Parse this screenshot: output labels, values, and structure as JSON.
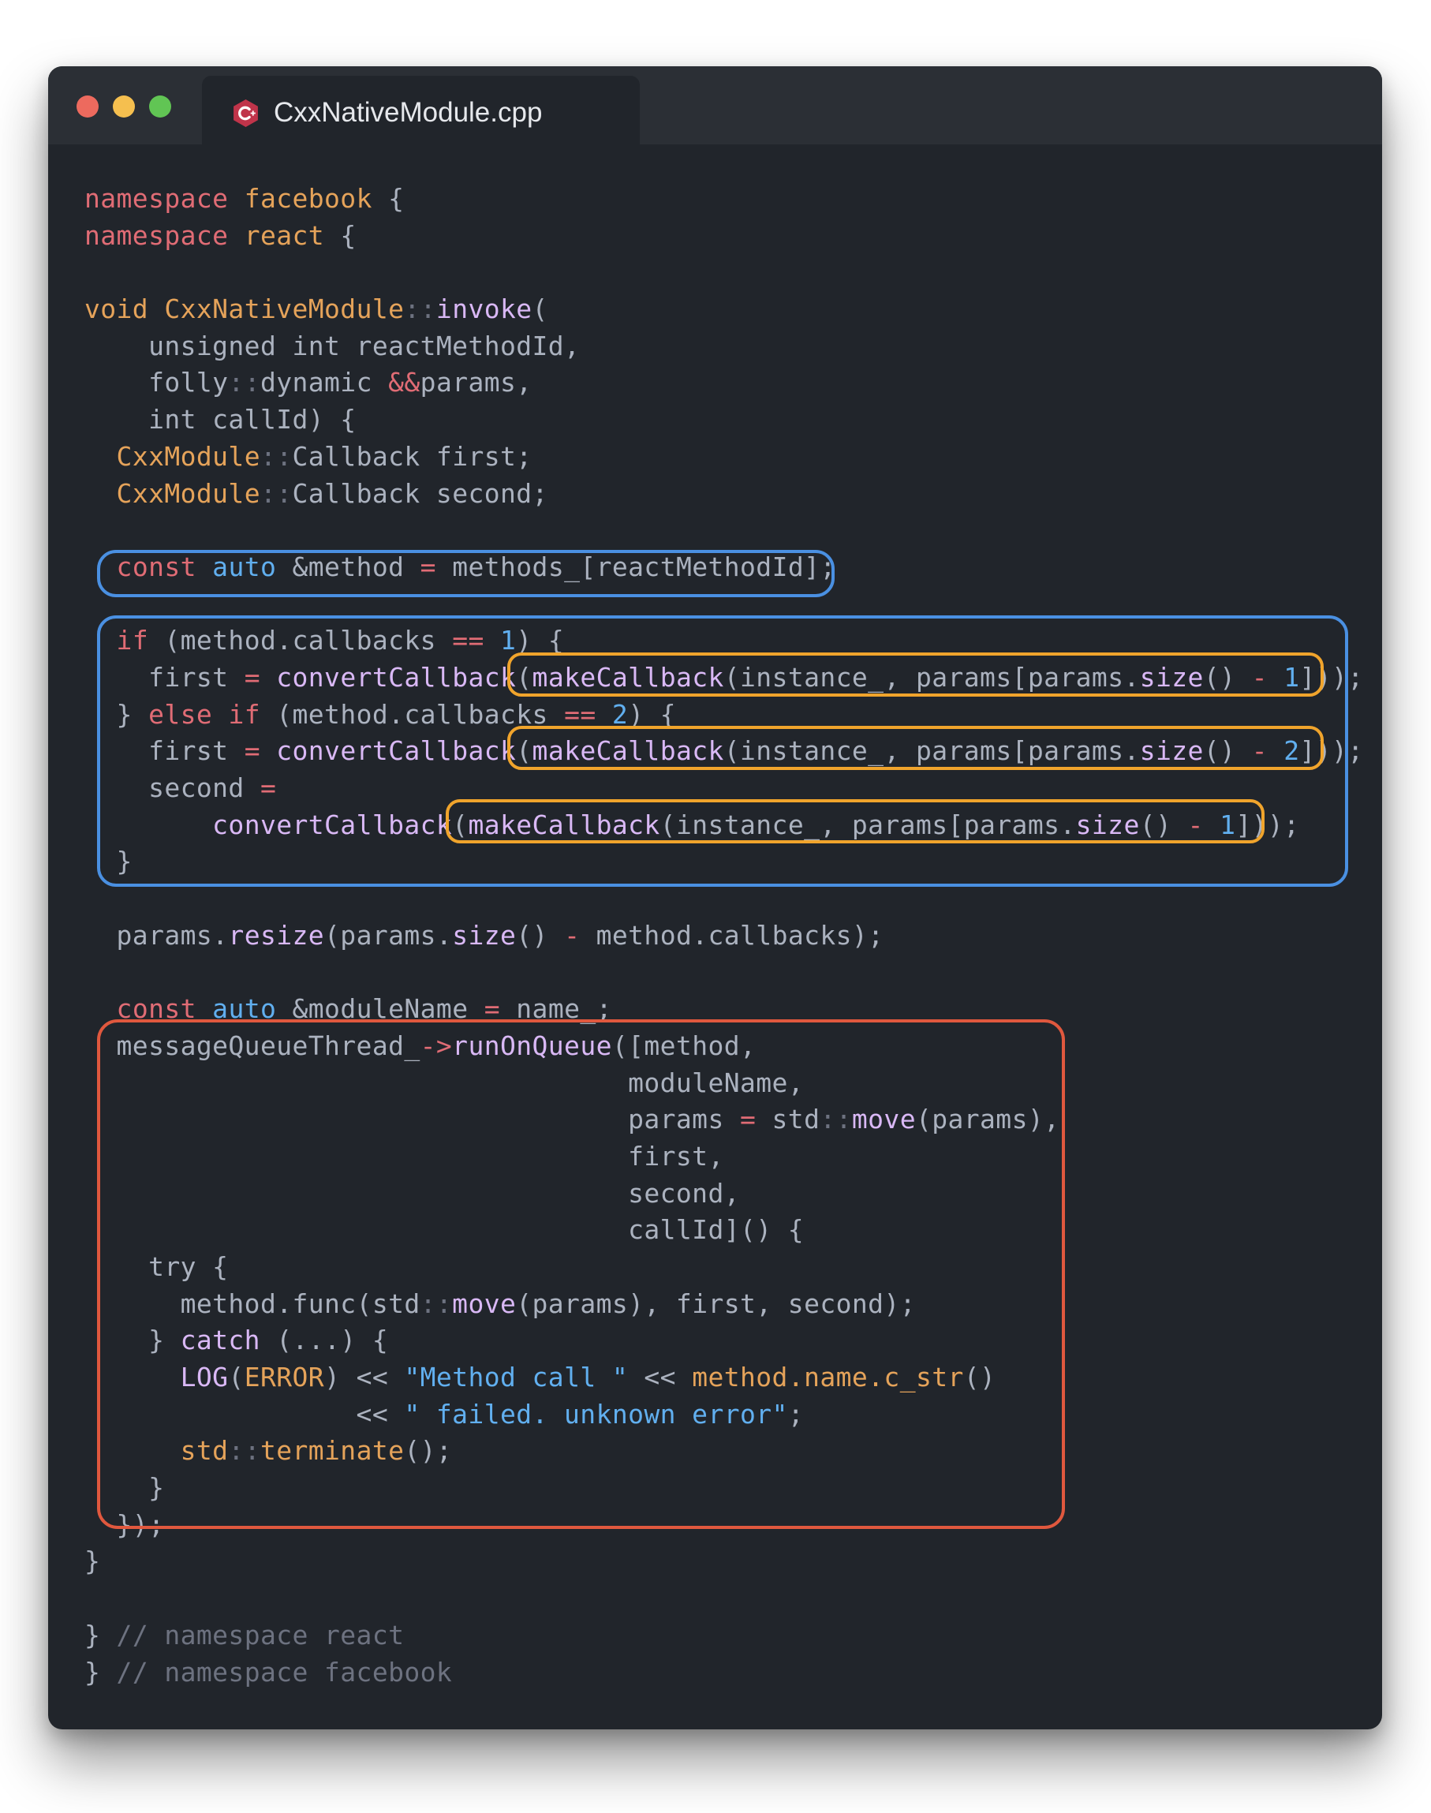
{
  "window": {
    "tab_title": "CxxNativeModule.cpp",
    "tab_icon": "cpp-file-icon"
  },
  "colors": {
    "keyword": "#e06c75",
    "type": "#e5a35a",
    "accent_blue": "#61afef",
    "function": "#d9b8f5",
    "comment": "#6d7280",
    "highlight_blue": "#4a90e2",
    "highlight_orange": "#f0a42c",
    "highlight_red": "#e0583e"
  },
  "code": {
    "lines": [
      [
        [
          "namespace",
          "kw"
        ],
        [
          " ",
          ""
        ],
        [
          "facebook",
          "ty"
        ],
        [
          " {",
          ""
        ]
      ],
      [
        [
          "namespace",
          "kw"
        ],
        [
          " ",
          ""
        ],
        [
          "react",
          "ty"
        ],
        [
          " {",
          ""
        ]
      ],
      [],
      [
        [
          "void",
          "ty"
        ],
        [
          " ",
          ""
        ],
        [
          "CxxNativeModule",
          "ty"
        ],
        [
          "::",
          "cm"
        ],
        [
          "invoke",
          "fn"
        ],
        [
          "(",
          ""
        ]
      ],
      [
        [
          "    unsigned int reactMethodId,",
          ""
        ]
      ],
      [
        [
          "    folly",
          ""
        ],
        [
          "::",
          "cm"
        ],
        [
          "dynamic ",
          ""
        ],
        [
          "&&",
          "op"
        ],
        [
          "params,",
          ""
        ]
      ],
      [
        [
          "    int callId) {",
          ""
        ]
      ],
      [
        [
          "  ",
          ""
        ],
        [
          "CxxModule",
          "ty"
        ],
        [
          "::",
          "cm"
        ],
        [
          "Callback first;",
          ""
        ]
      ],
      [
        [
          "  ",
          ""
        ],
        [
          "CxxModule",
          "ty"
        ],
        [
          "::",
          "cm"
        ],
        [
          "Callback second;",
          ""
        ]
      ],
      [],
      [
        [
          "  ",
          ""
        ],
        [
          "const",
          "kw"
        ],
        [
          " ",
          ""
        ],
        [
          "auto",
          "bl"
        ],
        [
          " &method ",
          ""
        ],
        [
          "=",
          "op"
        ],
        [
          " methods_[reactMethodId];",
          ""
        ]
      ],
      [],
      [
        [
          "  ",
          ""
        ],
        [
          "if",
          "kw"
        ],
        [
          " (method.callbacks ",
          ""
        ],
        [
          "==",
          "op"
        ],
        [
          " ",
          ""
        ],
        [
          "1",
          "num"
        ],
        [
          ") {",
          ""
        ]
      ],
      [
        [
          "    first ",
          ""
        ],
        [
          "=",
          "op"
        ],
        [
          " ",
          ""
        ],
        [
          "convertCallback",
          "fn"
        ],
        [
          "(",
          ""
        ],
        [
          "makeCallback",
          "fn"
        ],
        [
          "(instance_, params[params.",
          ""
        ],
        [
          "size",
          "fn"
        ],
        [
          "() ",
          ""
        ],
        [
          "-",
          "op"
        ],
        [
          " ",
          ""
        ],
        [
          "1",
          "num"
        ],
        [
          "]));",
          ""
        ]
      ],
      [
        [
          "  } ",
          ""
        ],
        [
          "else",
          "kw"
        ],
        [
          " ",
          ""
        ],
        [
          "if",
          "kw"
        ],
        [
          " (method.callbacks ",
          ""
        ],
        [
          "==",
          "op"
        ],
        [
          " ",
          ""
        ],
        [
          "2",
          "num"
        ],
        [
          ") {",
          ""
        ]
      ],
      [
        [
          "    first ",
          ""
        ],
        [
          "=",
          "op"
        ],
        [
          " ",
          ""
        ],
        [
          "convertCallback",
          "fn"
        ],
        [
          "(",
          ""
        ],
        [
          "makeCallback",
          "fn"
        ],
        [
          "(instance_, params[params.",
          ""
        ],
        [
          "size",
          "fn"
        ],
        [
          "() ",
          ""
        ],
        [
          "-",
          "op"
        ],
        [
          " ",
          ""
        ],
        [
          "2",
          "num"
        ],
        [
          "]));",
          ""
        ]
      ],
      [
        [
          "    second ",
          ""
        ],
        [
          "=",
          "op"
        ]
      ],
      [
        [
          "        ",
          ""
        ],
        [
          "convertCallback",
          "fn"
        ],
        [
          "(",
          ""
        ],
        [
          "makeCallback",
          "fn"
        ],
        [
          "(instance_, params[params.",
          ""
        ],
        [
          "size",
          "fn"
        ],
        [
          "() ",
          ""
        ],
        [
          "-",
          "op"
        ],
        [
          " ",
          ""
        ],
        [
          "1",
          "num"
        ],
        [
          "]));",
          ""
        ]
      ],
      [
        [
          "  }",
          ""
        ]
      ],
      [],
      [
        [
          "  params.",
          ""
        ],
        [
          "resize",
          "fn"
        ],
        [
          "(params.",
          ""
        ],
        [
          "size",
          "fn"
        ],
        [
          "() ",
          ""
        ],
        [
          "-",
          "op"
        ],
        [
          " method.callbacks);",
          ""
        ]
      ],
      [],
      [
        [
          "  ",
          ""
        ],
        [
          "const",
          "kw"
        ],
        [
          " ",
          ""
        ],
        [
          "auto",
          "bl"
        ],
        [
          " &moduleName ",
          ""
        ],
        [
          "=",
          "op"
        ],
        [
          " name_;",
          ""
        ]
      ],
      [
        [
          "  messageQueueThread_",
          ""
        ],
        [
          "->",
          "op"
        ],
        [
          "runOnQueue",
          "fn"
        ],
        [
          "([method,",
          ""
        ]
      ],
      [
        [
          "                                  moduleName,",
          ""
        ]
      ],
      [
        [
          "                                  params ",
          ""
        ],
        [
          "=",
          "op"
        ],
        [
          " std",
          ""
        ],
        [
          "::",
          "cm"
        ],
        [
          "move",
          "fn"
        ],
        [
          "(params),",
          ""
        ]
      ],
      [
        [
          "                                  first,",
          ""
        ]
      ],
      [
        [
          "                                  second,",
          ""
        ]
      ],
      [
        [
          "                                  callId]() {",
          ""
        ]
      ],
      [
        [
          "    try {",
          ""
        ]
      ],
      [
        [
          "      method.func(std",
          ""
        ],
        [
          "::",
          "cm"
        ],
        [
          "move",
          "fn"
        ],
        [
          "(params), first, second);",
          ""
        ]
      ],
      [
        [
          "    } ",
          ""
        ],
        [
          "catch",
          "fn"
        ],
        [
          " (...) {",
          ""
        ]
      ],
      [
        [
          "      ",
          ""
        ],
        [
          "LOG",
          "fn"
        ],
        [
          "(",
          ""
        ],
        [
          "ERROR",
          "ty"
        ],
        [
          ") << ",
          ""
        ],
        [
          "\"Method call \"",
          "str"
        ],
        [
          " << ",
          ""
        ],
        [
          "method.name.c_str",
          "ty"
        ],
        [
          "()",
          ""
        ]
      ],
      [
        [
          "                 << ",
          ""
        ],
        [
          "\" failed. unknown error\"",
          "str"
        ],
        [
          ";",
          ""
        ]
      ],
      [
        [
          "      ",
          ""
        ],
        [
          "std",
          "ty"
        ],
        [
          "::",
          "cm"
        ],
        [
          "terminate",
          "ty"
        ],
        [
          "();",
          ""
        ]
      ],
      [
        [
          "    }",
          ""
        ]
      ],
      [
        [
          "  });",
          ""
        ]
      ],
      [
        [
          "}",
          ""
        ]
      ],
      [],
      [
        [
          "} ",
          ""
        ],
        [
          "// namespace react",
          "cm"
        ]
      ],
      [
        [
          "} ",
          ""
        ],
        [
          "// namespace facebook",
          "cm"
        ]
      ]
    ]
  }
}
